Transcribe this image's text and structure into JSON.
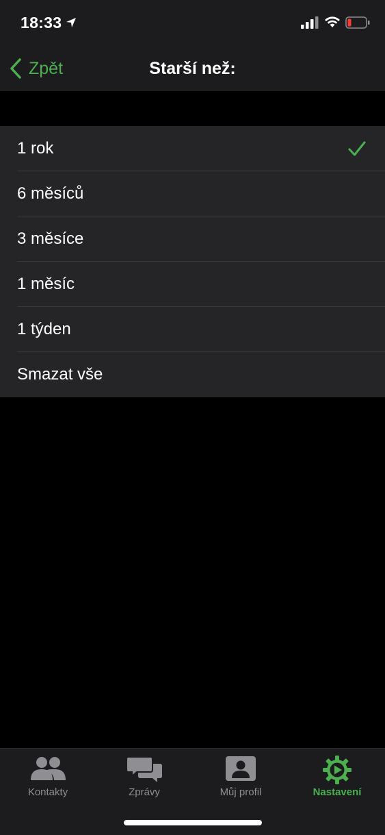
{
  "status_bar": {
    "time": "18:33"
  },
  "nav": {
    "back_label": "Zpět",
    "title": "Starší než:"
  },
  "options": [
    {
      "label": "1 rok",
      "selected": true
    },
    {
      "label": "6 měsíců",
      "selected": false
    },
    {
      "label": "3 měsíce",
      "selected": false
    },
    {
      "label": "1 měsíc",
      "selected": false
    },
    {
      "label": "1 týden",
      "selected": false
    },
    {
      "label": "Smazat vše",
      "selected": false
    }
  ],
  "tabs": [
    {
      "label": "Kontakty",
      "icon": "contacts-icon",
      "active": false
    },
    {
      "label": "Zprávy",
      "icon": "messages-icon",
      "active": false
    },
    {
      "label": "Můj profil",
      "icon": "profile-icon",
      "active": false
    },
    {
      "label": "Nastavení",
      "icon": "settings-gear-icon",
      "active": true
    }
  ],
  "colors": {
    "accent": "#4caf50",
    "inactive": "#8e8e93",
    "battery_low": "#ff3b30"
  }
}
